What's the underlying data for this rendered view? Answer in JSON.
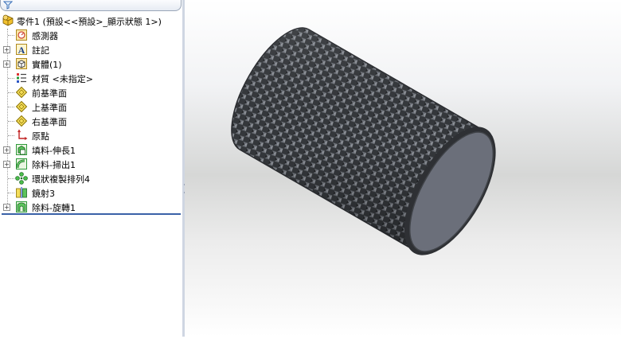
{
  "feature_tree": {
    "root_label": "零件1 (預設<<預設>_顯示狀態 1>)",
    "items": [
      {
        "label": "感測器",
        "icon": "sensor-icon",
        "expandable": false
      },
      {
        "label": "註記",
        "icon": "annotation-icon",
        "expandable": true
      },
      {
        "label": "實體(1)",
        "icon": "solid-bodies-icon",
        "expandable": true
      },
      {
        "label": "材質 <未指定>",
        "icon": "material-icon",
        "expandable": false
      },
      {
        "label": "前基準面",
        "icon": "plane-icon",
        "expandable": false
      },
      {
        "label": "上基準面",
        "icon": "plane-icon",
        "expandable": false
      },
      {
        "label": "右基準面",
        "icon": "plane-icon",
        "expandable": false
      },
      {
        "label": "原點",
        "icon": "origin-icon",
        "expandable": false
      },
      {
        "label": "填料-伸長1",
        "icon": "extrude-icon",
        "expandable": true
      },
      {
        "label": "除料-掃出1",
        "icon": "sweep-cut-icon",
        "expandable": true
      },
      {
        "label": "環狀複製排列4",
        "icon": "circular-pattern-icon",
        "expandable": false
      },
      {
        "label": "鏡射3",
        "icon": "mirror-icon",
        "expandable": false
      },
      {
        "label": "除料-旋轉1",
        "icon": "revolve-cut-icon",
        "expandable": true
      }
    ]
  },
  "colors": {
    "part_dark": "#3f4247",
    "part_face": "#6b6f7a",
    "rollback": "#3a62a8",
    "feature_icon_green": "#2f9a3a",
    "plane_icon_yellow": "#e2c21a"
  }
}
